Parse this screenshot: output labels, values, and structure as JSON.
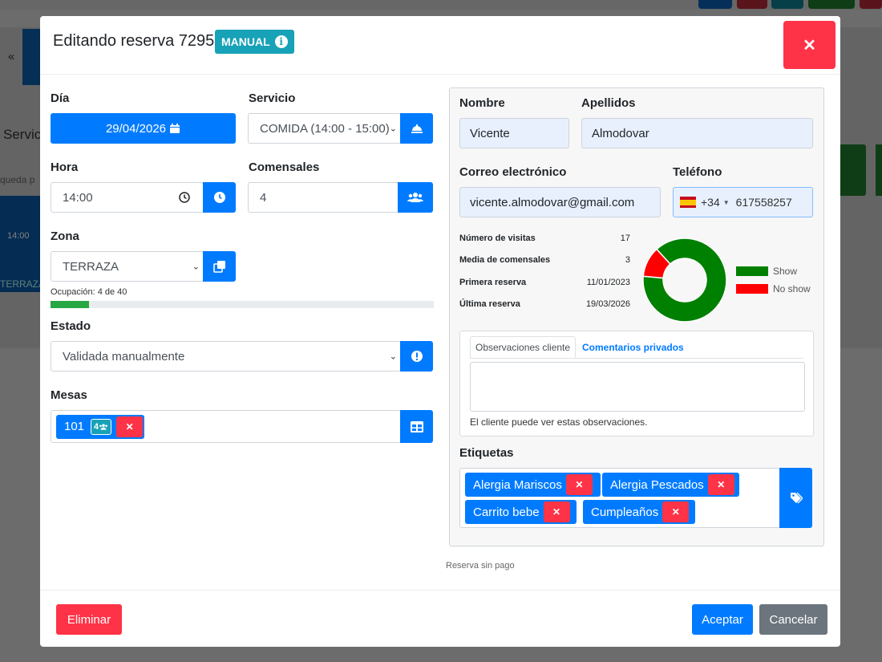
{
  "background": {
    "left_text": "Servic",
    "search_hint": "queda p",
    "time": "14:00",
    "zone_tag": "TERRAZA"
  },
  "modal": {
    "title": "Editando reserva 72959",
    "badge": "MANUAL",
    "close_icon": "times-icon"
  },
  "form": {
    "dia": {
      "label": "Día",
      "value": "29/04/2026"
    },
    "servicio": {
      "label": "Servicio",
      "value": "COMIDA (14:00 - 15:00)"
    },
    "hora": {
      "label": "Hora",
      "value": "14:00"
    },
    "comensales": {
      "label": "Comensales",
      "value": "4"
    },
    "zona": {
      "label": "Zona",
      "value": "TERRAZA"
    },
    "ocupacion": {
      "text": "Ocupación: 4 de 40",
      "fraction": 0.1
    },
    "estado": {
      "label": "Estado",
      "value": "Validada manualmente"
    },
    "mesas": {
      "label": "Mesas",
      "table_number": "101",
      "table_capacity": "4"
    }
  },
  "client": {
    "nombre": {
      "label": "Nombre",
      "value": "Vicente"
    },
    "apellidos": {
      "label": "Apellidos",
      "value": "Almodovar"
    },
    "correo": {
      "label": "Correo electrónico",
      "value": "vicente.almodovar@gmail.com"
    },
    "telefono": {
      "label": "Teléfono",
      "prefix": "+34",
      "value": "617558257"
    },
    "stats": [
      {
        "label": "Número de visitas",
        "value": "17"
      },
      {
        "label": "Media de comensales",
        "value": "3"
      },
      {
        "label": "Primera reserva",
        "value": "11/01/2023"
      },
      {
        "label": "Última reserva",
        "value": "19/03/2026"
      }
    ],
    "observaciones": {
      "tab_cliente": "Observaciones cliente",
      "tab_privados": "Comentarios privados",
      "note": "El cliente puede ver estas observaciones."
    },
    "etiquetas": {
      "label": "Etiquetas",
      "tags": [
        "Alergia Mariscos",
        "Alergia Pescados",
        "Carrito bebe",
        "Cumpleaños"
      ]
    }
  },
  "chart_data": {
    "type": "pie",
    "categories": [
      "Show",
      "No show"
    ],
    "values": [
      15,
      2
    ],
    "colors": [
      "#008000",
      "#ff0000"
    ],
    "legend_position": "right"
  },
  "footer": {
    "payment_note": "Reserva sin pago",
    "delete_label": "Eliminar",
    "accept_label": "Aceptar",
    "cancel_label": "Cancelar"
  }
}
